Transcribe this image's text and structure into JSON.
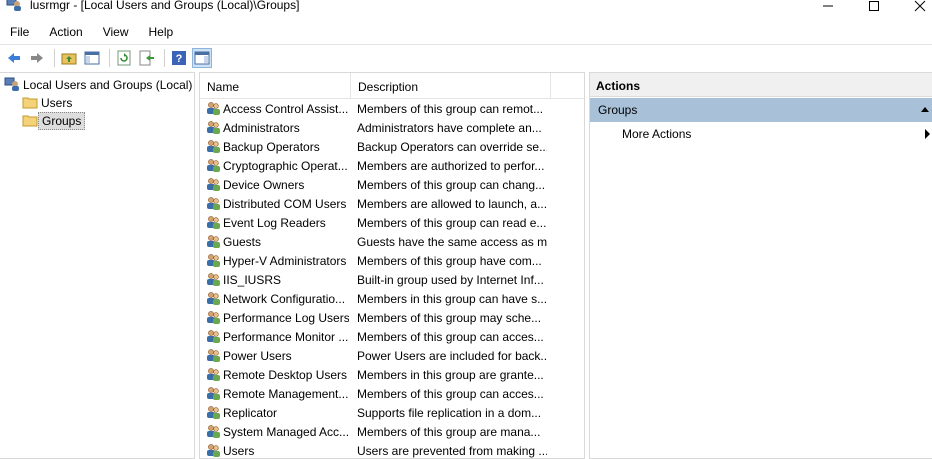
{
  "window": {
    "title": "lusrmgr - [Local Users and Groups (Local)\\Groups]"
  },
  "menu": [
    "File",
    "Action",
    "View",
    "Help"
  ],
  "toolbar": {
    "icons": [
      "back-icon",
      "forward-icon",
      "up-folder-icon",
      "show-hide-tree-icon",
      "refresh-icon",
      "export-list-icon",
      "help-icon",
      "show-hide-action-pane-icon"
    ]
  },
  "tree": {
    "root": "Local Users and Groups (Local)",
    "children": [
      "Users",
      "Groups"
    ],
    "selected": "Groups"
  },
  "list": {
    "columns": [
      "Name",
      "Description"
    ],
    "rows": [
      {
        "name": "Access Control Assist...",
        "description": "Members of this group can remot..."
      },
      {
        "name": "Administrators",
        "description": "Administrators have complete an..."
      },
      {
        "name": "Backup Operators",
        "description": "Backup Operators can override se..."
      },
      {
        "name": "Cryptographic Operat...",
        "description": "Members are authorized to perfor..."
      },
      {
        "name": "Device Owners",
        "description": "Members of this group can chang..."
      },
      {
        "name": "Distributed COM Users",
        "description": "Members are allowed to launch, a..."
      },
      {
        "name": "Event Log Readers",
        "description": "Members of this group can read e..."
      },
      {
        "name": "Guests",
        "description": "Guests have the same access as m..."
      },
      {
        "name": "Hyper-V Administrators",
        "description": "Members of this group have com..."
      },
      {
        "name": "IIS_IUSRS",
        "description": "Built-in group used by Internet Inf..."
      },
      {
        "name": "Network Configuratio...",
        "description": "Members in this group can have s..."
      },
      {
        "name": "Performance Log Users",
        "description": "Members of this group may sche..."
      },
      {
        "name": "Performance Monitor ...",
        "description": "Members of this group can acces..."
      },
      {
        "name": "Power Users",
        "description": "Power Users are included for back..."
      },
      {
        "name": "Remote Desktop Users",
        "description": "Members in this group are grante..."
      },
      {
        "name": "Remote Management...",
        "description": "Members of this group can acces..."
      },
      {
        "name": "Replicator",
        "description": "Supports file replication in a dom..."
      },
      {
        "name": "System Managed Acc...",
        "description": "Members of this group are mana..."
      },
      {
        "name": "Users",
        "description": "Users are prevented from making ..."
      }
    ]
  },
  "actions": {
    "header": "Actions",
    "group": "Groups",
    "items": [
      "More Actions"
    ]
  },
  "colors": {
    "actions_group_bg": "#a8c1d9",
    "selection_bg": "#dddddd"
  }
}
